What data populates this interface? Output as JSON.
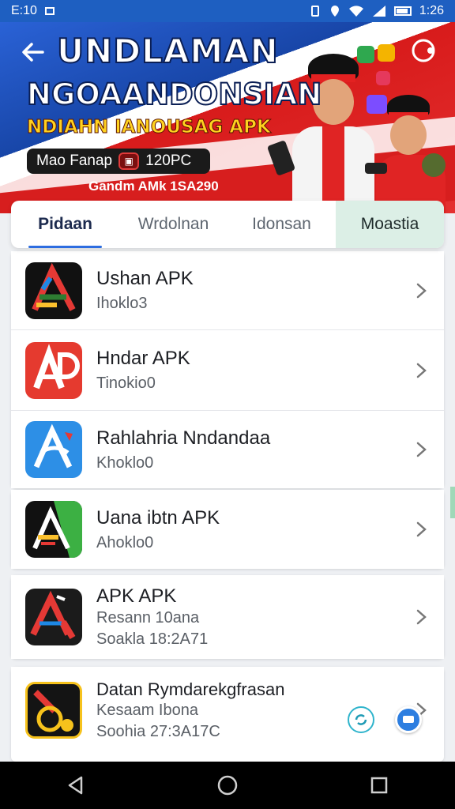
{
  "status_bar": {
    "time": "E:10",
    "right_time": "1:26"
  },
  "hero": {
    "title_line1": "UNDLAMAN",
    "title_line2": "NGOAANDONSIAN",
    "subtitle": "NDIAHN IANOUSAG APK",
    "pill_label": "Mao Fanap",
    "pill_value": "120PC",
    "footer": "Gandm AMk 1SA290"
  },
  "tabs": [
    {
      "label": "Pidaan"
    },
    {
      "label": "Wrdolnan"
    },
    {
      "label": "Idonsan"
    },
    {
      "label": "Moastia"
    }
  ],
  "apps": [
    {
      "name": "Ushan APK",
      "sub": "Ihoklo3"
    },
    {
      "name": "Hndar APK",
      "sub": "Tinokio0"
    },
    {
      "name": "Rahlahria Nndandaa",
      "sub": "Khoklo0"
    },
    {
      "name": "Uana ibtn APK",
      "sub": "Ahoklo0"
    },
    {
      "name": "APK APK",
      "sub": "Resann 10ana",
      "sub2": "Soakla 18:2A71"
    },
    {
      "name": "Datan Rymdarekgfrasan",
      "sub": "Kesaam Ibona",
      "sub2": "Soohia 27:3A17C"
    }
  ],
  "colors": {
    "accent": "#2d6de0",
    "banner_red": "#d71e1e",
    "banner_blue": "#1e5fc1"
  }
}
